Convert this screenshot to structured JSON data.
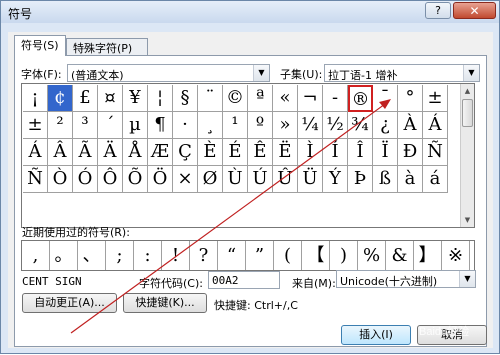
{
  "window": {
    "title": "符号",
    "help_label": "?",
    "close_label": "✕"
  },
  "tabs": [
    {
      "label": "符号(S)",
      "active": true
    },
    {
      "label": "特殊字符(P)",
      "active": false
    }
  ],
  "font_field": {
    "label": "字体(F):",
    "value": "(普通文本)"
  },
  "subset_field": {
    "label": "子集(U):",
    "value": "拉丁语-1 增补"
  },
  "symbol_rows": [
    [
      "¡",
      "¢",
      "£",
      "¤",
      "¥",
      "¦",
      "§",
      "¨",
      "©",
      "ª",
      "«",
      "¬",
      "-",
      "®",
      "¯",
      "°",
      "±"
    ],
    [
      "±",
      "²",
      "³",
      "´",
      "µ",
      "¶",
      "·",
      "¸",
      "¹",
      "º",
      "»",
      "¼",
      "½",
      "¾",
      "¿",
      "À",
      "Á"
    ],
    [
      "Á",
      "Â",
      "Ã",
      "Ä",
      "Å",
      "Æ",
      "Ç",
      "È",
      "É",
      "Ê",
      "Ë",
      "Ì",
      "Í",
      "Î",
      "Ï",
      "Ð",
      "Ñ"
    ],
    [
      "Ñ",
      "Ò",
      "Ó",
      "Ô",
      "Õ",
      "Ö",
      "×",
      "Ø",
      "Ù",
      "Ú",
      "Û",
      "Ü",
      "Ý",
      "Þ",
      "ß",
      "à",
      "á"
    ]
  ],
  "selected_symbol": "¢",
  "highlighted_symbol": "®",
  "recent_label": "近期使用过的符号(R):",
  "recent_symbols": [
    ",",
    "。",
    "、",
    ";",
    ":",
    "!",
    "?",
    "“",
    "”",
    "(",
    "【",
    ")",
    "%",
    "&",
    "】",
    "※"
  ],
  "char_name": "CENT SIGN",
  "char_code": {
    "label": "字符代码(C):",
    "value": "00A2"
  },
  "from": {
    "label": "来自(M):",
    "value": "Unicode(十六进制)"
  },
  "autocorrect_button": "自动更正(A)...",
  "shortcut_button": "快捷键(K)...",
  "shortcut_text": "快捷键: Ctrl+/,C",
  "insert_button": "插入(I)",
  "cancel_button": "取消",
  "watermark": "Baidu经验",
  "accent_colors": {
    "highlight_box": "#d02020",
    "arrow": "#c02020",
    "selection": "#3366cc"
  }
}
